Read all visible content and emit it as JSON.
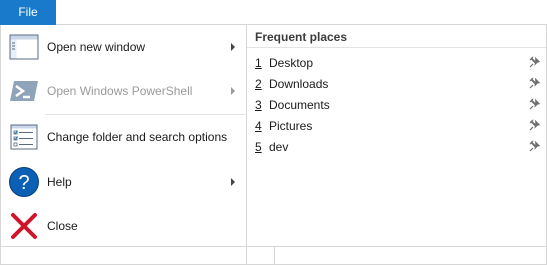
{
  "file_tab": {
    "label": "File"
  },
  "menu": {
    "items": [
      {
        "label": "Open new window",
        "icon": "new-window-icon",
        "has_submenu": true,
        "enabled": true
      },
      {
        "label": "Open Windows PowerShell",
        "icon": "powershell-icon",
        "has_submenu": true,
        "enabled": false
      },
      {
        "label": "Change folder and search options",
        "icon": "folder-options-icon",
        "has_submenu": false,
        "enabled": true
      },
      {
        "label": "Help",
        "icon": "help-icon",
        "has_submenu": true,
        "enabled": true
      },
      {
        "label": "Close",
        "icon": "close-icon",
        "has_submenu": false,
        "enabled": true
      }
    ]
  },
  "frequent_places": {
    "header": "Frequent places",
    "items": [
      {
        "number": "1",
        "name": "Desktop"
      },
      {
        "number": "2",
        "name": "Downloads"
      },
      {
        "number": "3",
        "name": "Documents"
      },
      {
        "number": "4",
        "name": "Pictures"
      },
      {
        "number": "5",
        "name": "dev"
      }
    ]
  },
  "colors": {
    "accent": "#1979ca",
    "help_blue": "#0b5fb4",
    "close_red": "#d0152a",
    "disabled_text": "#9a9a9a",
    "border": "#d6d6d6"
  }
}
